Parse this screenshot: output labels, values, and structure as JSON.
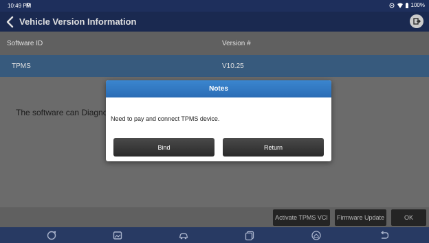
{
  "status_bar": {
    "time": "10:49 PM",
    "notification": "P",
    "battery": "100%"
  },
  "title_bar": {
    "title": "Vehicle Version Information"
  },
  "table": {
    "headers": [
      "Software ID",
      "Version #"
    ],
    "rows": [
      {
        "software_id": "TPMS",
        "version": "V10.25"
      }
    ]
  },
  "content": {
    "description": "The software can Diagnost"
  },
  "actions": {
    "activate_label": "Activate TPMS VCI",
    "firmware_label": "Firmware Update",
    "ok_label": "OK"
  },
  "dialog": {
    "title": "Notes",
    "message": "Need to pay and connect TPMS device.",
    "bind_label": "Bind",
    "return_label": "Return"
  },
  "nav_bar": {
    "icons": [
      "refresh-icon",
      "gallery-icon",
      "vehicle-icon",
      "recent-apps-icon",
      "home-icon",
      "back-icon"
    ]
  },
  "colors": {
    "header_bg": "#1e2f5c",
    "selected_row": "#3f678f",
    "dialog_header": "#2e74bd",
    "nav_bg": "#283a63"
  }
}
